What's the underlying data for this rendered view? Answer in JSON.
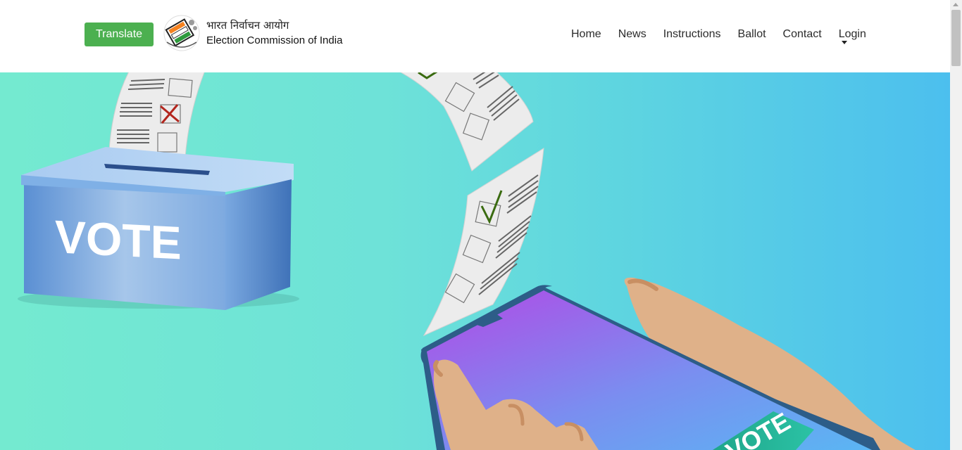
{
  "header": {
    "translate_label": "Translate",
    "logo_hindi": "भारत निर्वाचन आयोग",
    "logo_english": "Election Commission of India"
  },
  "nav": {
    "items": [
      "Home",
      "News",
      "Instructions",
      "Ballot",
      "Contact",
      "Login"
    ]
  },
  "hero": {
    "box_label": "VOTE",
    "phone_button_label": "VOTE"
  },
  "colors": {
    "translate_button": "#4cb050",
    "hero_gradient_start": "#74ead0",
    "hero_gradient_end": "#4cbfee",
    "ballot_box": "#6c9fd9",
    "phone_screen_start": "#b14ae6",
    "phone_screen_end": "#5ab6f3"
  },
  "icons": {
    "logo": "eci-logo-icon",
    "login_caret": "caret-down-icon"
  }
}
